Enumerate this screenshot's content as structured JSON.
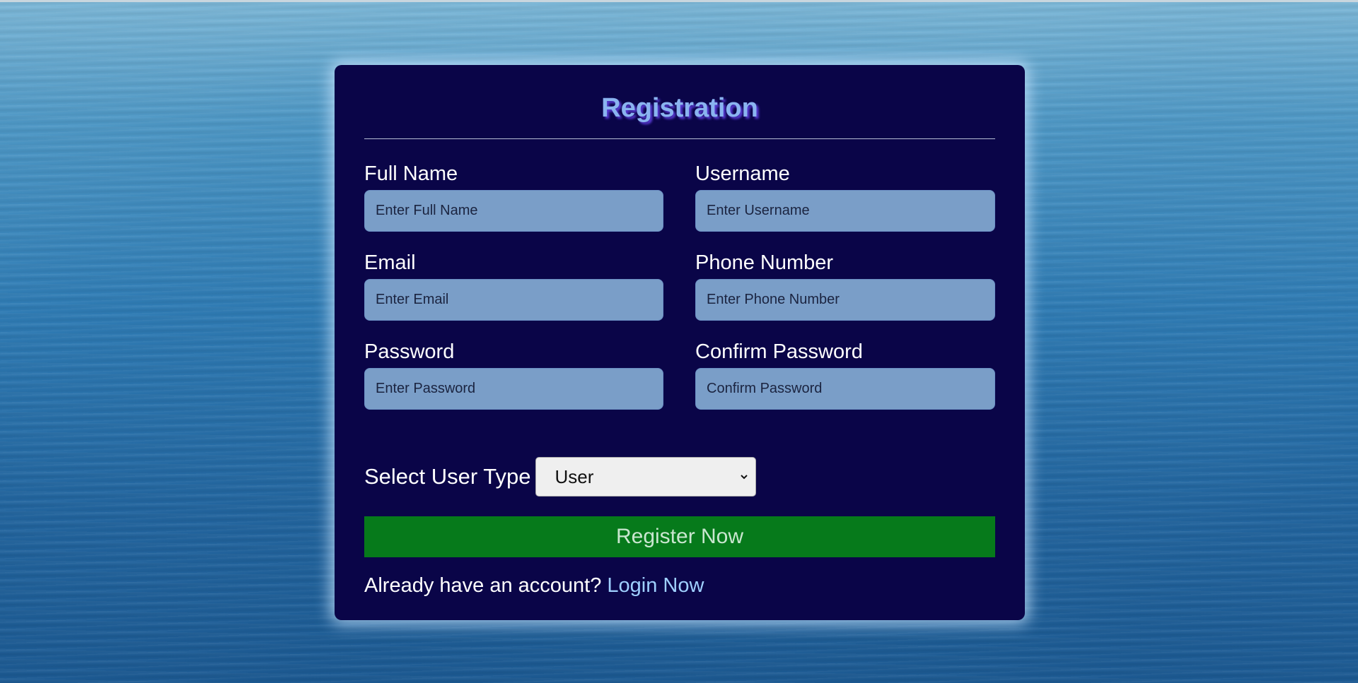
{
  "form": {
    "title": "Registration",
    "fields": [
      {
        "label": "Full Name",
        "placeholder": "Enter Full Name",
        "value": ""
      },
      {
        "label": "Username",
        "placeholder": "Enter Username",
        "value": ""
      },
      {
        "label": "Email",
        "placeholder": "Enter Email",
        "value": ""
      },
      {
        "label": "Phone Number",
        "placeholder": "Enter Phone Number",
        "value": ""
      },
      {
        "label": "Password",
        "placeholder": "Enter Password",
        "value": ""
      },
      {
        "label": "Confirm Password",
        "placeholder": "Confirm Password",
        "value": ""
      }
    ],
    "user_type": {
      "label": "Select User Type",
      "selected": "User",
      "icon": "chevron-down-icon"
    },
    "submit_label": "Register Now",
    "login_prompt": {
      "text": "Already have an account?",
      "link_label": "Login Now"
    }
  },
  "colors": {
    "card_background": "#0a0548",
    "title": "#8ab4f0",
    "input_background": "#7a9ec8",
    "submit_background": "#067a1b",
    "link": "#9fd0ff"
  }
}
